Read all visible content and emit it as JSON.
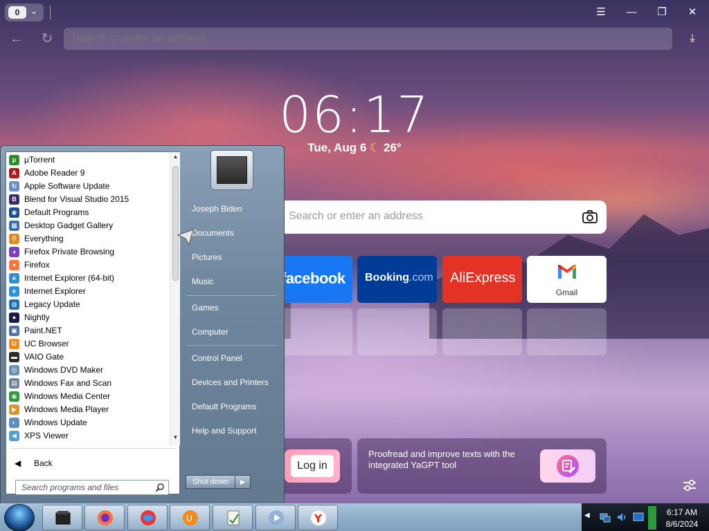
{
  "browser": {
    "tab_count": "0",
    "address_placeholder": "Search or enter an address",
    "clock": "06:17",
    "date": "Tue, Aug 6",
    "weather": "26°",
    "search_placeholder": "Search or enter an address",
    "tiles": [
      {
        "label": "facebook",
        "color": "#1877f2"
      },
      {
        "label": "Booking",
        "suffix": ".com",
        "color": "#003b95"
      },
      {
        "label": "AliExpress",
        "color": "#e43225"
      },
      {
        "label": "Gmail",
        "color": "#ffffff"
      }
    ],
    "login_label": "Log in",
    "yagpt_text": "Proofread and improve texts with the integrated YaGPT tool"
  },
  "start_menu": {
    "programs": [
      {
        "label": "µTorrent",
        "icon": "utorrent-icon",
        "color": "#2e8b2e",
        "glyph": "µ"
      },
      {
        "label": "Adobe Reader 9",
        "icon": "adobe-reader-icon",
        "color": "#b3161b",
        "glyph": "A"
      },
      {
        "label": "Apple Software Update",
        "icon": "apple-update-icon",
        "color": "#6a8fc4",
        "glyph": "↻"
      },
      {
        "label": "Blend for Visual Studio 2015",
        "icon": "blend-icon",
        "color": "#3a2b6b",
        "glyph": "B"
      },
      {
        "label": "Default Programs",
        "icon": "default-programs-icon",
        "color": "#1f4f8f",
        "glyph": "◉"
      },
      {
        "label": "Desktop Gadget Gallery",
        "icon": "gadget-gallery-icon",
        "color": "#3c6da6",
        "glyph": "▦"
      },
      {
        "label": "Everything",
        "icon": "everything-icon",
        "color": "#e08a1e",
        "glyph": "⚲"
      },
      {
        "label": "Firefox Private Browsing",
        "icon": "firefox-private-icon",
        "color": "#7b3fc4",
        "glyph": "◕"
      },
      {
        "label": "Firefox",
        "icon": "firefox-icon",
        "color": "#ff7139",
        "glyph": "●"
      },
      {
        "label": "Internet Explorer (64-bit)",
        "icon": "ie64-icon",
        "color": "#2f8fd8",
        "glyph": "e"
      },
      {
        "label": "Internet Explorer",
        "icon": "ie-icon",
        "color": "#2f8fd8",
        "glyph": "e"
      },
      {
        "label": "Legacy Update",
        "icon": "legacy-update-icon",
        "color": "#1f6fb8",
        "glyph": "◍"
      },
      {
        "label": "Nightly",
        "icon": "nightly-icon",
        "color": "#1b1b4a",
        "glyph": "●"
      },
      {
        "label": "Paint.NET",
        "icon": "paintnet-icon",
        "color": "#4a6fa5",
        "glyph": "▣"
      },
      {
        "label": "UC Browser",
        "icon": "uc-browser-icon",
        "color": "#f08a1c",
        "glyph": "U"
      },
      {
        "label": "VAIO Gate",
        "icon": "vaio-gate-icon",
        "color": "#2b2b2b",
        "glyph": "▬"
      },
      {
        "label": "Windows DVD Maker",
        "icon": "dvd-maker-icon",
        "color": "#6d8fb0",
        "glyph": "◎"
      },
      {
        "label": "Windows Fax and Scan",
        "icon": "fax-scan-icon",
        "color": "#6f8297",
        "glyph": "▤"
      },
      {
        "label": "Windows Media Center",
        "icon": "media-center-icon",
        "color": "#2f9a3a",
        "glyph": "◉"
      },
      {
        "label": "Windows Media Player",
        "icon": "media-player-icon",
        "color": "#e0932a",
        "glyph": "▶"
      },
      {
        "label": "Windows Update",
        "icon": "windows-update-icon",
        "color": "#5b8fbf",
        "glyph": "◐"
      },
      {
        "label": "XPS Viewer",
        "icon": "xps-viewer-icon",
        "color": "#4fa0d8",
        "glyph": "◀"
      }
    ],
    "back_label": "Back",
    "search_placeholder": "Search programs and files",
    "right_items": [
      {
        "label": "Joseph Biden",
        "name": "start-right-user"
      },
      {
        "label": "Documents",
        "name": "start-right-documents"
      },
      {
        "label": "Pictures",
        "name": "start-right-pictures"
      },
      {
        "label": "Music",
        "name": "start-right-music"
      },
      {
        "label": "Games",
        "name": "start-right-games"
      },
      {
        "label": "Computer",
        "name": "start-right-computer"
      },
      {
        "label": "Control Panel",
        "name": "start-right-control-panel"
      },
      {
        "label": "Devices and Printers",
        "name": "start-right-devices-printers"
      },
      {
        "label": "Default Programs",
        "name": "start-right-default-programs"
      },
      {
        "label": "Help and Support",
        "name": "start-right-help-support"
      }
    ],
    "shutdown_label": "Shut down"
  },
  "taskbar": {
    "time": "6:17 AM",
    "date": "8/6/2024",
    "apps": [
      {
        "icon": "vaio-gate-taskbar-icon"
      },
      {
        "icon": "firefox-taskbar-icon"
      },
      {
        "icon": "browser-swirl-taskbar-icon"
      },
      {
        "icon": "uc-browser-taskbar-icon"
      },
      {
        "icon": "document-taskbar-icon"
      },
      {
        "icon": "media-player-taskbar-icon"
      },
      {
        "icon": "yandex-browser-taskbar-icon"
      }
    ]
  }
}
